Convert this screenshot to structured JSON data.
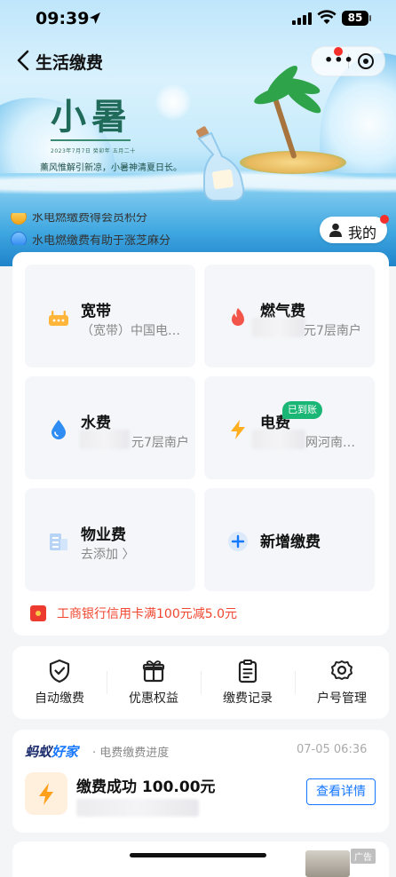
{
  "status_bar": {
    "time": "09:39",
    "battery": "85"
  },
  "nav": {
    "title": "生活缴费",
    "more_glyph": "•••"
  },
  "banner": {
    "title": "小暑",
    "date_line": "2023年7月7日  癸卯年  五月二十",
    "poem": "薰风惟解引新凉，小暑神清夏日长。"
  },
  "ticker": [
    "水电燃缴费得会员积分",
    "水电燃缴费有助于涨芝麻分"
  ],
  "my_button": {
    "label": "我的"
  },
  "tiles": [
    {
      "id": "broadband",
      "name": "宽带",
      "sub": "（宽带）中国电…",
      "icon": "router-icon"
    },
    {
      "id": "gas",
      "name": "燃气费",
      "sub": "元7层南户",
      "icon": "flame-icon"
    },
    {
      "id": "water",
      "name": "水费",
      "sub": "元7层南户",
      "icon": "water-drop-icon"
    },
    {
      "id": "electricity",
      "name": "电费",
      "sub": "网河南…",
      "badge": "已到账",
      "icon": "lightning-icon"
    },
    {
      "id": "property",
      "name": "物业费",
      "sub": "去添加 〉",
      "icon": "building-icon"
    },
    {
      "id": "add",
      "name": "新增缴费",
      "icon": "plus-icon"
    }
  ],
  "promo": {
    "text": "工商银行信用卡满100元减5.0元"
  },
  "tools": [
    {
      "label": "自动缴费",
      "icon": "shield-check-icon"
    },
    {
      "label": "优惠权益",
      "icon": "gift-icon"
    },
    {
      "label": "缴费记录",
      "icon": "clipboard-icon"
    },
    {
      "label": "户号管理",
      "icon": "gear-icon"
    }
  ],
  "progress": {
    "brand_a": "蚂蚁",
    "brand_b": "好家",
    "tag": "· 电费缴费进度",
    "time": "07-05 06:36",
    "title": "缴费成功 100.00元",
    "button": "查看详情"
  },
  "ad": {
    "tag": "广告"
  },
  "colors": {
    "accent": "#1677ff",
    "promo": "#f0462f",
    "badge": "#1ab675",
    "brand_dark": "#1b2b6b"
  }
}
